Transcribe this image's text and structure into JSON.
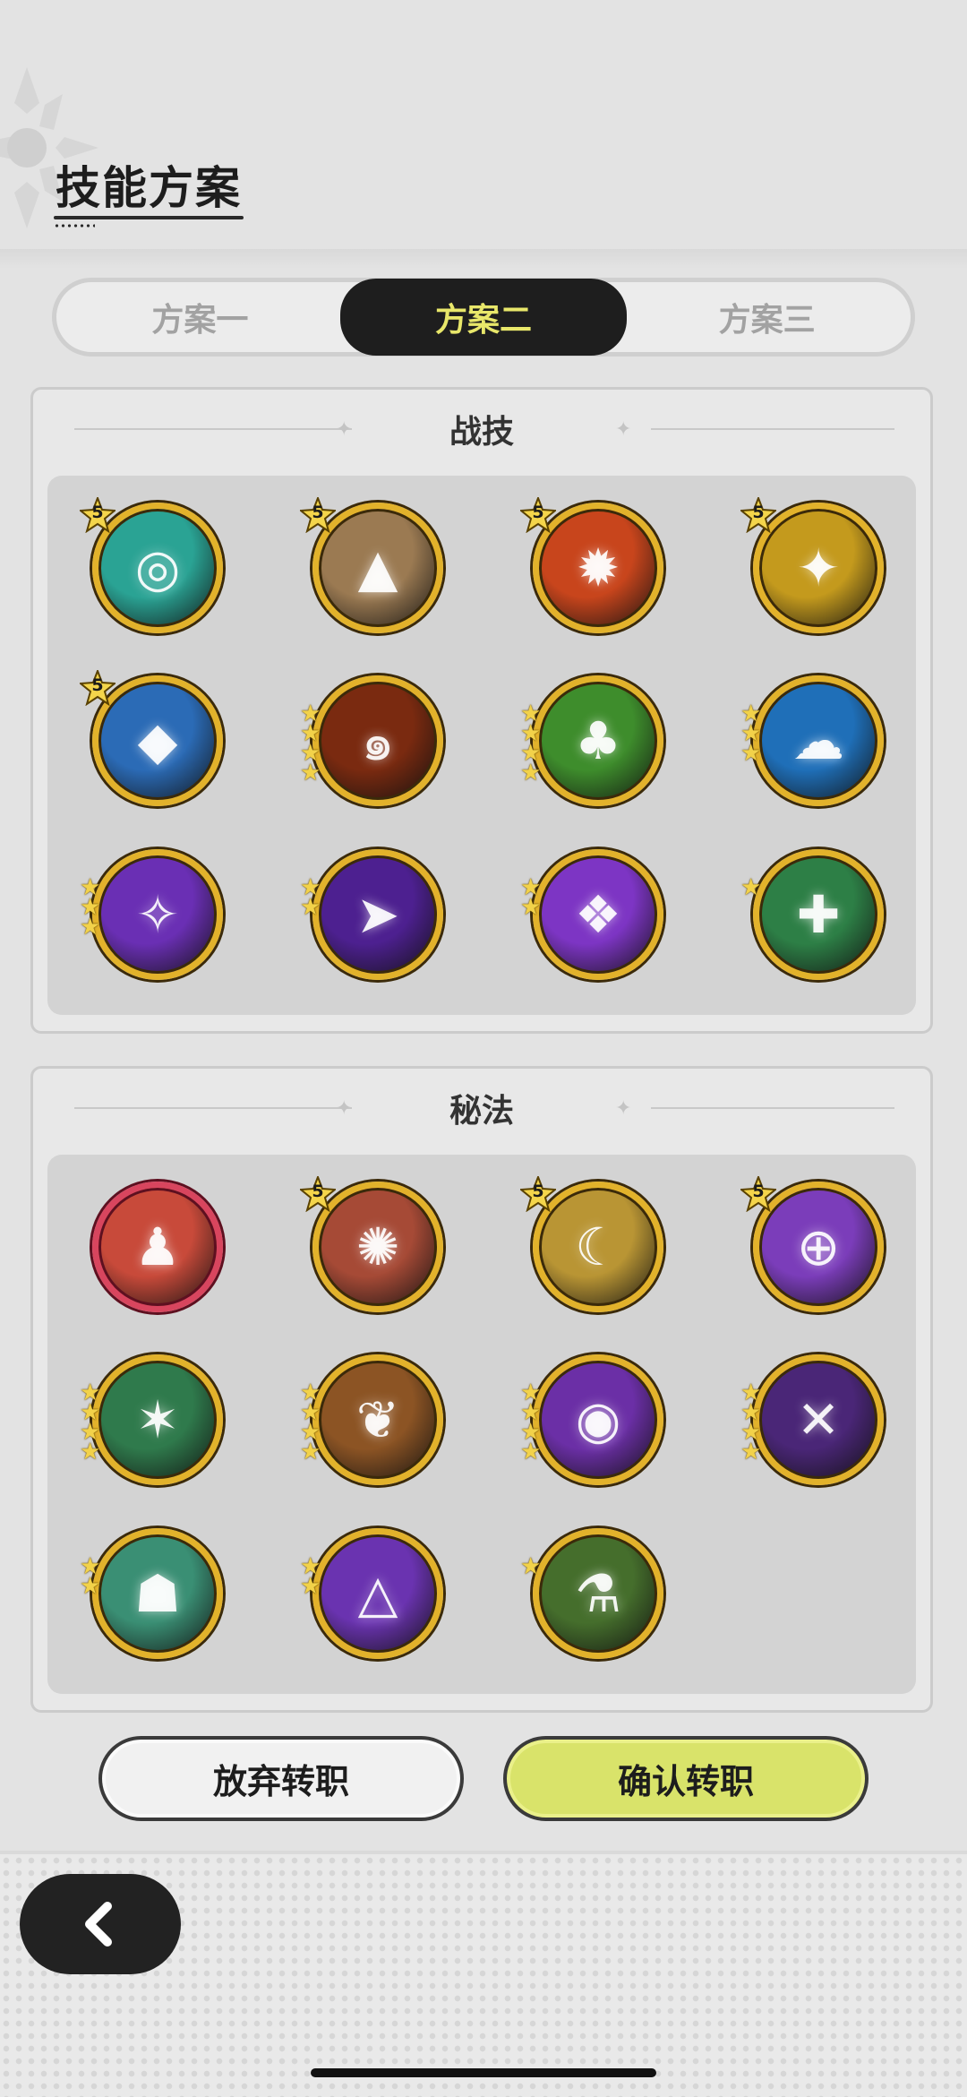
{
  "header": {
    "title": "技能方案"
  },
  "tabs": [
    {
      "label": "方案一",
      "active": false
    },
    {
      "label": "方案二",
      "active": true
    },
    {
      "label": "方案三",
      "active": false
    }
  ],
  "combat": {
    "title": "战技",
    "skills": [
      {
        "name": "swirl-wind-skill-icon",
        "rank": "5",
        "stars": 0,
        "bg": "#2aa394",
        "glyph": "◎"
      },
      {
        "name": "rock-burst-skill-icon",
        "rank": "5",
        "stars": 0,
        "bg": "#9b7a52",
        "glyph": "▲"
      },
      {
        "name": "fireball-skill-icon",
        "rank": "5",
        "stars": 0,
        "bg": "#c8451c",
        "glyph": "✹"
      },
      {
        "name": "golden-sparkle-skill-icon",
        "rank": "5",
        "stars": 0,
        "bg": "#c49a1d",
        "glyph": "✦"
      },
      {
        "name": "ice-shard-skill-icon",
        "rank": "5",
        "stars": 0,
        "bg": "#2b6bb6",
        "glyph": "◆"
      },
      {
        "name": "flame-spiral-skill-icon",
        "rank": "",
        "stars": 4,
        "bg": "#7a2a10",
        "glyph": "๑"
      },
      {
        "name": "tree-stump-skill-icon",
        "rank": "",
        "stars": 4,
        "bg": "#3e8d2c",
        "glyph": "♣"
      },
      {
        "name": "water-spirit-skill-icon",
        "rank": "",
        "stars": 3,
        "bg": "#1f6fb8",
        "glyph": "☁"
      },
      {
        "name": "shadow-slash-skill-icon",
        "rank": "",
        "stars": 3,
        "bg": "#6a2fb4",
        "glyph": "✧"
      },
      {
        "name": "void-arrow-skill-icon",
        "rank": "",
        "stars": 2,
        "bg": "#4d2090",
        "glyph": "➤"
      },
      {
        "name": "arcane-eye-skill-icon",
        "rank": "",
        "stars": 2,
        "bg": "#7d35c4",
        "glyph": "❖"
      },
      {
        "name": "healing-orbs-skill-icon",
        "rank": "",
        "stars": 1,
        "bg": "#2d7f46",
        "glyph": "✚"
      }
    ]
  },
  "secret": {
    "title": "秘法",
    "skills": [
      {
        "name": "flame-figure-secret-icon",
        "rank": "",
        "stars": 0,
        "bg": "#c84a3a",
        "glyph": "♟",
        "frame": "red"
      },
      {
        "name": "fire-burst-secret-icon",
        "rank": "5",
        "stars": 0,
        "bg": "#a64a36",
        "glyph": "✺"
      },
      {
        "name": "golden-claw-secret-icon",
        "rank": "5",
        "stars": 0,
        "bg": "#b99534",
        "glyph": "☾"
      },
      {
        "name": "arcane-rune-secret-icon",
        "rank": "5",
        "stars": 0,
        "bg": "#7b3dba",
        "glyph": "⊕"
      },
      {
        "name": "emerald-wings-secret-icon",
        "rank": "",
        "stars": 4,
        "bg": "#2f7a4c",
        "glyph": "✶"
      },
      {
        "name": "amber-tree-secret-icon",
        "rank": "",
        "stars": 4,
        "bg": "#8c5424",
        "glyph": "❦"
      },
      {
        "name": "mystic-eye-secret-icon",
        "rank": "",
        "stars": 4,
        "bg": "#6b2fa6",
        "glyph": "◉"
      },
      {
        "name": "void-dagger-secret-icon",
        "rank": "",
        "stars": 4,
        "bg": "#4a2677",
        "glyph": "✕"
      },
      {
        "name": "jade-golem-secret-icon",
        "rank": "",
        "stars": 2,
        "bg": "#3a8f74",
        "glyph": "☗"
      },
      {
        "name": "violet-sigil-secret-icon",
        "rank": "",
        "stars": 2,
        "bg": "#6a33b0",
        "glyph": "△"
      },
      {
        "name": "potion-flask-secret-icon",
        "rank": "",
        "stars": 1,
        "bg": "#456e2c",
        "glyph": "⚗"
      }
    ]
  },
  "buttons": {
    "abandon": "放弃转职",
    "confirm": "确认转职"
  },
  "nav": {
    "back_icon": "chevron-left-icon"
  },
  "colors": {
    "accent": "#e8e76a",
    "frame_gold": "#e2b22b",
    "confirm_bg": "#d9e36a"
  }
}
